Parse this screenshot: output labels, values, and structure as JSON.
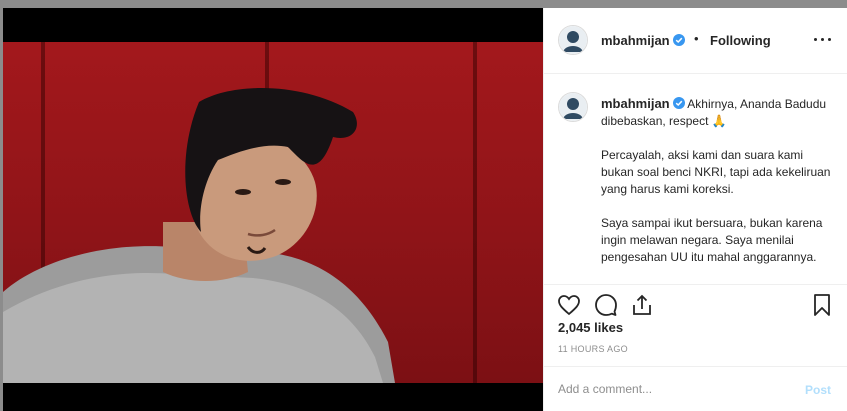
{
  "post": {
    "username": "mbahmijan",
    "separator": "•",
    "follow_status": "Following",
    "caption_first": "Akhirnya, Ananda Badudu dibebaskan, respect 🙏",
    "caption_paragraphs": [
      "Percayalah, aksi kami dan suara kami bukan soal benci NKRI, tapi ada kekeliruan yang harus kami koreksi.",
      "Saya sampai ikut bersuara, bukan karena ingin melawan negara. Saya menilai pengesahan UU itu mahal anggarannya."
    ],
    "likes": "2,045 likes",
    "time_ago": "11 HOURS AGO"
  },
  "comment_box": {
    "placeholder": "Add a comment...",
    "post_label": "Post"
  },
  "icons": {
    "like": "heart-icon",
    "comment": "comment-bubble-icon",
    "share": "share-icon",
    "save": "bookmark-icon",
    "verified": "verified-badge-icon",
    "more": "more-options-icon"
  },
  "colors": {
    "verified_blue": "#3897f0",
    "post_button_disabled": "#b2dffc",
    "muted_text": "#8e8e8e",
    "wall_red": "#a3181c"
  }
}
